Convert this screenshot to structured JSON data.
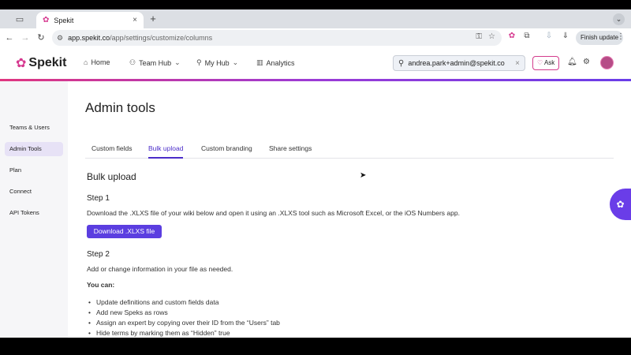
{
  "browser": {
    "tab_title": "Spekit",
    "new_tab": "+",
    "tab_close": "×",
    "url_host": "app.spekit.co",
    "url_path": "/app/settings/customize/columns",
    "finish_update": "Finish update"
  },
  "appbar": {
    "logo_text": "Spekit",
    "nav": [
      {
        "label": "Home"
      },
      {
        "label": "Team Hub"
      },
      {
        "label": "My Hub"
      },
      {
        "label": "Analytics"
      }
    ],
    "search_value": "andrea.park+admin@spekit.co",
    "ask_label": "Ask"
  },
  "sidebar": {
    "items": [
      {
        "label": "Teams & Users"
      },
      {
        "label": "Admin Tools"
      },
      {
        "label": "Plan"
      },
      {
        "label": "Connect"
      },
      {
        "label": "API Tokens"
      }
    ]
  },
  "main": {
    "title": "Admin tools",
    "tabs": [
      {
        "label": "Custom fields"
      },
      {
        "label": "Bulk upload"
      },
      {
        "label": "Custom branding"
      },
      {
        "label": "Share settings"
      }
    ],
    "section_title": "Bulk upload",
    "step1_title": "Step 1",
    "step1_text": "Download the .XLXS file of your wiki below and open it using an .XLXS tool such as Microsoft Excel, or the iOS Numbers app.",
    "download_button": "Download .XLXS file",
    "step2_title": "Step 2",
    "step2_text": "Add or change information in your file as needed.",
    "you_can": "You can:",
    "bullets": [
      "Update definitions and custom fields data",
      "Add new Speks as rows",
      "Assign an expert by copying over their ID from the “Users” tab",
      "Hide terms by marking them as “Hidden” true"
    ]
  },
  "colors": {
    "accent": "#5b3ee0",
    "brand_pink": "#d6388f"
  }
}
